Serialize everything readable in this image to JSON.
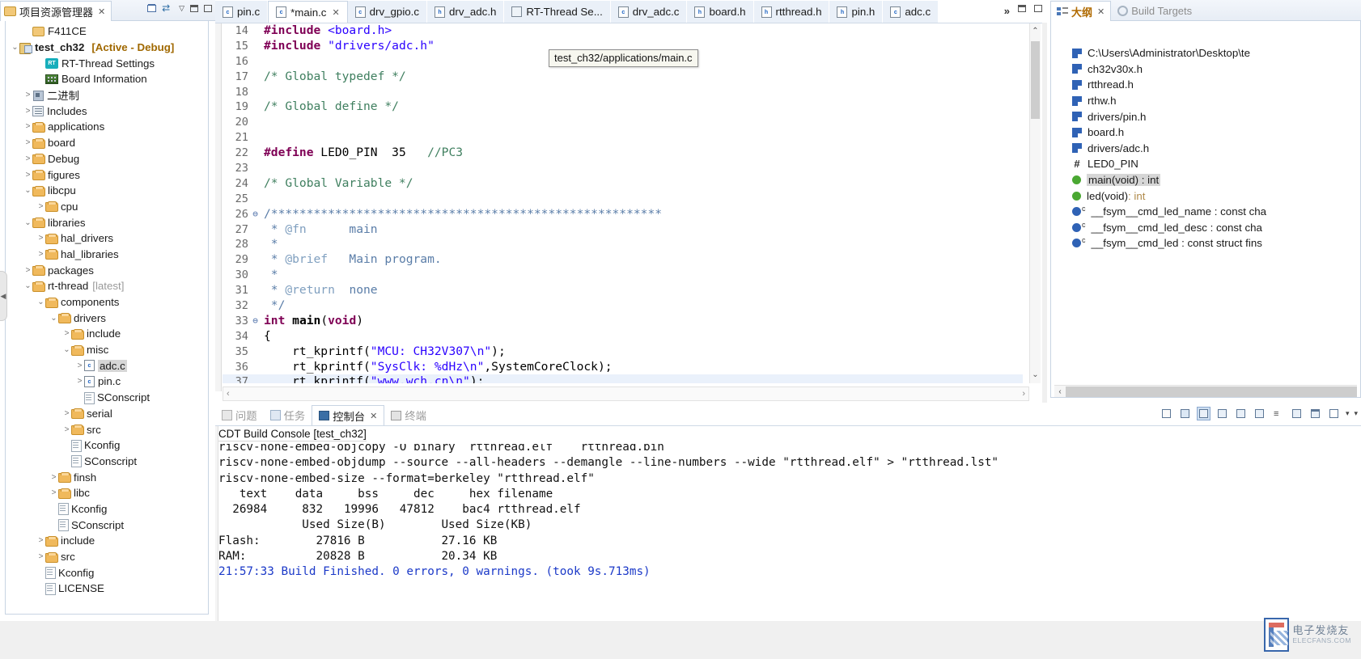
{
  "explorer": {
    "tab_label": "项目资源管理器",
    "tab_close": "✕",
    "toolbar": {
      "collapse_all": "collapse-all",
      "link_with_editor": "link-with-editor",
      "view_menu": "▽",
      "minimize": "▭",
      "maximize": "□"
    },
    "items": [
      {
        "label": "F411CE",
        "icon": "closed-folder-icon",
        "indent": 1,
        "arrow": "",
        "bold": false
      },
      {
        "label": "test_ch32",
        "icon": "project-icon",
        "indent": 0,
        "arrow": "⌄",
        "bold": true,
        "suffix": "[Active - Debug]"
      },
      {
        "label": "RT-Thread Settings",
        "icon": "rt-thread-icon",
        "indent": 2,
        "arrow": "",
        "bold": false
      },
      {
        "label": "Board Information",
        "icon": "board-icon",
        "indent": 2,
        "arrow": "",
        "bold": false
      },
      {
        "label": "二进制",
        "icon": "binaries-icon",
        "indent": 1,
        "arrow": ">",
        "bold": false
      },
      {
        "label": "Includes",
        "icon": "includes-icon",
        "indent": 1,
        "arrow": ">",
        "bold": false
      },
      {
        "label": "applications",
        "icon": "folder-icon",
        "indent": 1,
        "arrow": ">",
        "bold": false
      },
      {
        "label": "board",
        "icon": "folder-icon",
        "indent": 1,
        "arrow": ">",
        "bold": false
      },
      {
        "label": "Debug",
        "icon": "folder-icon",
        "indent": 1,
        "arrow": ">",
        "bold": false
      },
      {
        "label": "figures",
        "icon": "folder-icon",
        "indent": 1,
        "arrow": ">",
        "bold": false
      },
      {
        "label": "libcpu",
        "icon": "folder-icon",
        "indent": 1,
        "arrow": "⌄",
        "bold": false
      },
      {
        "label": "cpu",
        "icon": "folder-icon",
        "indent": 2,
        "arrow": ">",
        "bold": false
      },
      {
        "label": "libraries",
        "icon": "folder-icon",
        "indent": 1,
        "arrow": "⌄",
        "bold": false
      },
      {
        "label": "hal_drivers",
        "icon": "folder-icon",
        "indent": 2,
        "arrow": ">",
        "bold": false
      },
      {
        "label": "hal_libraries",
        "icon": "folder-icon",
        "indent": 2,
        "arrow": ">",
        "bold": false
      },
      {
        "label": "packages",
        "icon": "folder-icon",
        "indent": 1,
        "arrow": ">",
        "bold": false
      },
      {
        "label": "rt-thread",
        "icon": "folder-icon",
        "indent": 1,
        "arrow": "⌄",
        "bold": false,
        "dim": "[latest]"
      },
      {
        "label": "components",
        "icon": "folder-icon",
        "indent": 2,
        "arrow": "⌄",
        "bold": false
      },
      {
        "label": "drivers",
        "icon": "folder-icon",
        "indent": 3,
        "arrow": "⌄",
        "bold": false
      },
      {
        "label": "include",
        "icon": "folder-icon",
        "indent": 4,
        "arrow": ">",
        "bold": false
      },
      {
        "label": "misc",
        "icon": "folder-icon",
        "indent": 4,
        "arrow": "⌄",
        "bold": false
      },
      {
        "label": "adc.c",
        "icon": "c-file-icon",
        "indent": 5,
        "arrow": ">",
        "bold": false,
        "selected": true
      },
      {
        "label": "pin.c",
        "icon": "c-file-icon",
        "indent": 5,
        "arrow": ">",
        "bold": false
      },
      {
        "label": "SConscript",
        "icon": "file-icon",
        "indent": 5,
        "arrow": "",
        "bold": false
      },
      {
        "label": "serial",
        "icon": "folder-icon",
        "indent": 4,
        "arrow": ">",
        "bold": false
      },
      {
        "label": "src",
        "icon": "folder-icon",
        "indent": 4,
        "arrow": ">",
        "bold": false
      },
      {
        "label": "Kconfig",
        "icon": "file-icon",
        "indent": 4,
        "arrow": "",
        "bold": false
      },
      {
        "label": "SConscript",
        "icon": "file-icon",
        "indent": 4,
        "arrow": "",
        "bold": false
      },
      {
        "label": "finsh",
        "icon": "folder-icon",
        "indent": 3,
        "arrow": ">",
        "bold": false
      },
      {
        "label": "libc",
        "icon": "folder-icon",
        "indent": 3,
        "arrow": ">",
        "bold": false
      },
      {
        "label": "Kconfig",
        "icon": "file-icon",
        "indent": 3,
        "arrow": "",
        "bold": false
      },
      {
        "label": "SConscript",
        "icon": "file-icon",
        "indent": 3,
        "arrow": "",
        "bold": false
      },
      {
        "label": "include",
        "icon": "folder-icon",
        "indent": 2,
        "arrow": ">",
        "bold": false
      },
      {
        "label": "src",
        "icon": "folder-icon",
        "indent": 2,
        "arrow": ">",
        "bold": false
      },
      {
        "label": "Kconfig",
        "icon": "file-icon",
        "indent": 2,
        "arrow": "",
        "bold": false
      },
      {
        "label": "LICENSE",
        "icon": "file-icon",
        "indent": 2,
        "arrow": "",
        "bold": false
      }
    ]
  },
  "editor": {
    "tabs": [
      {
        "label": "pin.c",
        "icon": "c-file-icon",
        "active": false,
        "dirty": false
      },
      {
        "label": "*main.c",
        "icon": "c-file-icon",
        "active": true,
        "dirty": true,
        "close": "✕"
      },
      {
        "label": "drv_gpio.c",
        "icon": "c-file-icon",
        "active": false,
        "dirty": false
      },
      {
        "label": "drv_adc.h",
        "icon": "h-file-icon",
        "active": false,
        "dirty": false
      },
      {
        "label": "RT-Thread Se...",
        "icon": "rt-settings-icon",
        "active": false,
        "dirty": false
      },
      {
        "label": "drv_adc.c",
        "icon": "c-file-icon",
        "active": false,
        "dirty": false
      },
      {
        "label": "board.h",
        "icon": "h-file-icon",
        "active": false,
        "dirty": false
      },
      {
        "label": "rtthread.h",
        "icon": "h-file-icon",
        "active": false,
        "dirty": false
      },
      {
        "label": "pin.h",
        "icon": "h-file-icon",
        "active": false,
        "dirty": false
      },
      {
        "label": "adc.c",
        "icon": "c-file-icon",
        "active": false,
        "dirty": false
      }
    ],
    "more_tabs": "»",
    "more_tabs_count": "?",
    "minimize": "▭",
    "maximize": "□",
    "tooltip": "test_ch32/applications/main.c",
    "hscroll_left": "‹",
    "hscroll_right": "›",
    "lines": [
      {
        "n": "14",
        "fold": "",
        "mark": false,
        "hl": false,
        "tokens": [
          {
            "t": "#include ",
            "c": "kw"
          },
          {
            "t": "<board.h>",
            "c": "str"
          }
        ]
      },
      {
        "n": "15",
        "fold": "",
        "mark": false,
        "hl": false,
        "tokens": [
          {
            "t": "#include ",
            "c": "kw"
          },
          {
            "t": "\"drivers/adc.h\"",
            "c": "str"
          }
        ]
      },
      {
        "n": "16",
        "fold": "",
        "mark": false,
        "hl": false,
        "tokens": []
      },
      {
        "n": "17",
        "fold": "",
        "mark": false,
        "hl": false,
        "tokens": [
          {
            "t": "/* Global typedef */",
            "c": "cmt"
          }
        ]
      },
      {
        "n": "18",
        "fold": "",
        "mark": false,
        "hl": false,
        "tokens": []
      },
      {
        "n": "19",
        "fold": "",
        "mark": false,
        "hl": false,
        "tokens": [
          {
            "t": "/* Global define */",
            "c": "cmt"
          }
        ]
      },
      {
        "n": "20",
        "fold": "",
        "mark": false,
        "hl": false,
        "tokens": []
      },
      {
        "n": "21",
        "fold": "",
        "mark": false,
        "hl": false,
        "tokens": []
      },
      {
        "n": "22",
        "fold": "",
        "mark": false,
        "hl": false,
        "tokens": [
          {
            "t": "#define",
            "c": "kw"
          },
          {
            "t": " LED0_PIN  35   ",
            "c": "id"
          },
          {
            "t": "//PC3",
            "c": "cmt"
          }
        ]
      },
      {
        "n": "23",
        "fold": "",
        "mark": false,
        "hl": false,
        "tokens": []
      },
      {
        "n": "24",
        "fold": "",
        "mark": false,
        "hl": false,
        "tokens": [
          {
            "t": "/* Global Variable */",
            "c": "cmt"
          }
        ]
      },
      {
        "n": "25",
        "fold": "",
        "mark": false,
        "hl": false,
        "tokens": []
      },
      {
        "n": "26",
        "fold": "⊖",
        "mark": false,
        "hl": false,
        "tokens": [
          {
            "t": "/*******************************************************",
            "c": "stars"
          }
        ]
      },
      {
        "n": "27",
        "fold": "",
        "mark": false,
        "hl": false,
        "tokens": [
          {
            "t": " * ",
            "c": "doc"
          },
          {
            "t": "@fn",
            "c": "doctag"
          },
          {
            "t": "      main",
            "c": "doc"
          }
        ]
      },
      {
        "n": "28",
        "fold": "",
        "mark": false,
        "hl": false,
        "tokens": [
          {
            "t": " * ",
            "c": "doc"
          }
        ]
      },
      {
        "n": "29",
        "fold": "",
        "mark": false,
        "hl": false,
        "tokens": [
          {
            "t": " * ",
            "c": "doc"
          },
          {
            "t": "@brief",
            "c": "doctag"
          },
          {
            "t": "   Main program.",
            "c": "doc"
          }
        ]
      },
      {
        "n": "30",
        "fold": "",
        "mark": false,
        "hl": false,
        "tokens": [
          {
            "t": " * ",
            "c": "doc"
          }
        ]
      },
      {
        "n": "31",
        "fold": "",
        "mark": false,
        "hl": false,
        "tokens": [
          {
            "t": " * ",
            "c": "doc"
          },
          {
            "t": "@return",
            "c": "doctag"
          },
          {
            "t": "  none",
            "c": "doc"
          }
        ]
      },
      {
        "n": "32",
        "fold": "",
        "mark": false,
        "hl": false,
        "tokens": [
          {
            "t": " */",
            "c": "doc"
          }
        ]
      },
      {
        "n": "33",
        "fold": "⊖",
        "mark": true,
        "hl": false,
        "tokens": [
          {
            "t": "int ",
            "c": "kw"
          },
          {
            "t": "main",
            "c": "fn"
          },
          {
            "t": "(",
            "c": "id"
          },
          {
            "t": "void",
            "c": "kw"
          },
          {
            "t": ")",
            "c": "id"
          }
        ]
      },
      {
        "n": "34",
        "fold": "",
        "mark": true,
        "hl": false,
        "tokens": [
          {
            "t": "{",
            "c": "id"
          }
        ]
      },
      {
        "n": "35",
        "fold": "",
        "mark": true,
        "hl": false,
        "tokens": [
          {
            "t": "    rt_kprintf(",
            "c": "id"
          },
          {
            "t": "\"MCU: CH32V307\\n\"",
            "c": "str"
          },
          {
            "t": ");",
            "c": "id"
          }
        ]
      },
      {
        "n": "36",
        "fold": "",
        "mark": true,
        "hl": false,
        "tokens": [
          {
            "t": "    rt_kprintf(",
            "c": "id"
          },
          {
            "t": "\"SysClk: %dHz\\n\"",
            "c": "str"
          },
          {
            "t": ",SystemCoreClock);",
            "c": "id"
          }
        ]
      },
      {
        "n": "37",
        "fold": "",
        "mark": true,
        "hl": true,
        "tokens": [
          {
            "t": "    rt_kprintf(",
            "c": "id"
          },
          {
            "t": "\"www.wch.cn\\n\"",
            "c": "str"
          },
          {
            "t": ");",
            "c": "id"
          }
        ]
      }
    ]
  },
  "console": {
    "tabs": [
      {
        "label": "问题",
        "icon": "problems-icon",
        "active": false
      },
      {
        "label": "任务",
        "icon": "tasks-icon",
        "active": false
      },
      {
        "label": "控制台",
        "icon": "console-icon",
        "active": true,
        "close": "✕"
      },
      {
        "label": "终端",
        "icon": "terminal-icon",
        "active": false
      }
    ],
    "title": "CDT Build Console [test_ch32]",
    "toolbar": [
      "clear-console-icon",
      "scroll-lock-icon",
      "pin-console-icon",
      "display-selected-console-icon",
      "open-console-icon",
      "new-console-view-icon",
      "word-wrap-icon",
      "show-console-icon",
      "minimize-icon",
      "maximize-icon"
    ],
    "lines": [
      {
        "text": "riscv-none-embed-objcopy -O binary  rtthread.elf    rtthread.bin",
        "color": "black",
        "clipped_top": true
      },
      {
        "text": "riscv-none-embed-objdump --source --all-headers --demangle --line-numbers --wide \"rtthread.elf\" > \"rtthread.lst\"",
        "color": "black"
      },
      {
        "text": "riscv-none-embed-size --format=berkeley \"rtthread.elf\"",
        "color": "black"
      },
      {
        "text": "   text\t   data\t    bss\t    dec\t    hex\tfilename",
        "color": "black"
      },
      {
        "text": "  26984\t    832\t  19996\t  47812\t   bac4\trtthread.elf",
        "color": "black"
      },
      {
        "text": "",
        "color": "black"
      },
      {
        "text": "",
        "color": "black"
      },
      {
        "text": "            Used Size(B)        Used Size(KB)",
        "color": "black"
      },
      {
        "text": "Flash:        27816 B           27.16 KB",
        "color": "black"
      },
      {
        "text": "RAM:          20828 B           20.34 KB",
        "color": "black"
      },
      {
        "text": "",
        "color": "black"
      },
      {
        "text": "21:57:33 Build Finished. 0 errors, 0 warnings. (took 9s.713ms)",
        "color": "blue"
      }
    ]
  },
  "outline": {
    "tabs": [
      {
        "label": "大纲",
        "icon": "outline-icon",
        "active": true,
        "close": "✕"
      },
      {
        "label": "Build Targets",
        "icon": "build-targets-icon",
        "active": false
      }
    ],
    "toolbar": [
      "collapse-all-icon",
      "sort-icon",
      "hide-fields-icon",
      "hide-static-icon",
      "hide-nonpublic-icon"
    ],
    "items": [
      {
        "label": "C:\\Users\\Administrator\\Desktop\\te",
        "kind": "include",
        "selected": false
      },
      {
        "label": "ch32v30x.h",
        "kind": "include",
        "selected": false
      },
      {
        "label": "rtthread.h",
        "kind": "include",
        "selected": false
      },
      {
        "label": "rthw.h",
        "kind": "include",
        "selected": false
      },
      {
        "label": "drivers/pin.h",
        "kind": "include",
        "selected": false
      },
      {
        "label": "board.h",
        "kind": "include",
        "selected": false
      },
      {
        "label": "drivers/adc.h",
        "kind": "include",
        "selected": false
      },
      {
        "label": "LED0_PIN",
        "kind": "macro",
        "selected": false
      },
      {
        "label": "main(void) : int",
        "kind": "function",
        "selected": true
      },
      {
        "label": "led(void)",
        "kind": "function",
        "selected": false,
        "ret": " : int"
      },
      {
        "label": "__fsym__cmd_led_name : const cha",
        "kind": "variable-c",
        "selected": false
      },
      {
        "label": "__fsym__cmd_led_desc : const cha",
        "kind": "variable-c",
        "selected": false
      },
      {
        "label": "__fsym__cmd_led : const struct fins",
        "kind": "variable-c",
        "selected": false
      }
    ],
    "hscroll_left": "‹"
  },
  "watermark": {
    "big": "电子发烧友",
    "small": "ELECFANS.COM"
  },
  "colors": {
    "accent": "#2f62b5",
    "active_project": "#a06800",
    "keyword": "#7f0055",
    "string": "#2a00ff",
    "comment": "#3f7f5f",
    "doc_comment": "#5a7da8",
    "build_finished": "#1b39c8",
    "tab_bg": "#eaf0f8",
    "selection_gray": "#d6d6d6"
  }
}
